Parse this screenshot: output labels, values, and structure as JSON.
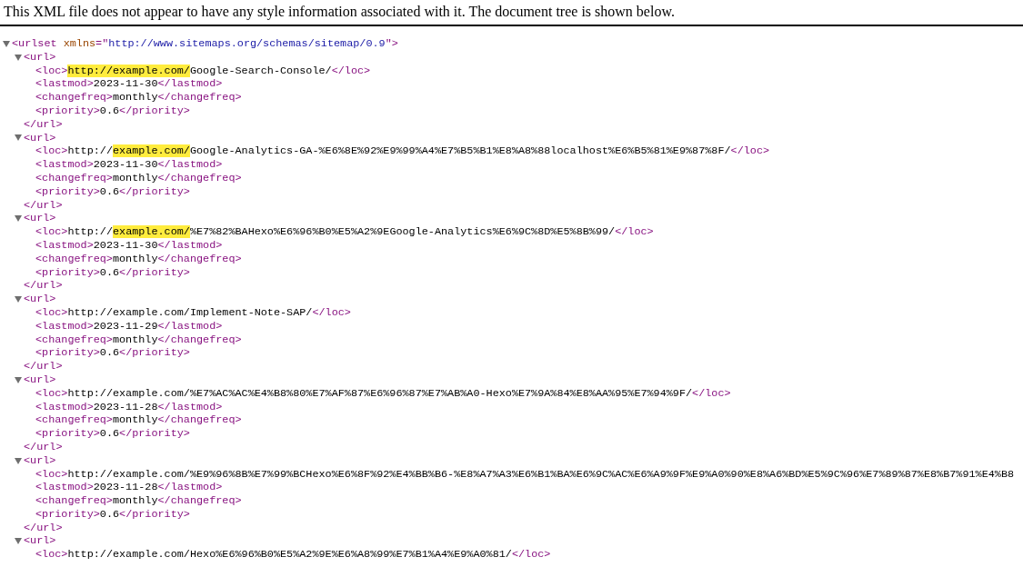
{
  "notice": "This XML file does not appear to have any style information associated with it. The document tree is shown below.",
  "tree": {
    "expanded": true,
    "open": [
      {
        "kind": "tag",
        "text": "<urlset"
      },
      {
        "kind": "attr",
        "text": " xmlns"
      },
      {
        "kind": "tag",
        "text": "=\""
      },
      {
        "kind": "value",
        "text": "http://www.sitemaps.org/schemas/sitemap/0.9"
      },
      {
        "kind": "tag",
        "text": "\">"
      }
    ],
    "children": [
      {
        "expanded": true,
        "open": [
          {
            "kind": "tag",
            "text": "<url>"
          }
        ],
        "close": [
          {
            "kind": "tag",
            "text": "</url>"
          }
        ],
        "children": [
          {
            "line": [
              {
                "kind": "tag",
                "text": "<loc>"
              },
              {
                "kind": "mark",
                "text": "http://example.com/"
              },
              {
                "kind": "text",
                "text": "Google-Search-Console/"
              },
              {
                "kind": "tag",
                "text": "</loc>"
              }
            ]
          },
          {
            "line": [
              {
                "kind": "tag",
                "text": "<lastmod>"
              },
              {
                "kind": "text",
                "text": "2023-11-30"
              },
              {
                "kind": "tag",
                "text": "</lastmod>"
              }
            ]
          },
          {
            "line": [
              {
                "kind": "tag",
                "text": "<changefreq>"
              },
              {
                "kind": "text",
                "text": "monthly"
              },
              {
                "kind": "tag",
                "text": "</changefreq>"
              }
            ]
          },
          {
            "line": [
              {
                "kind": "tag",
                "text": "<priority>"
              },
              {
                "kind": "text",
                "text": "0.6"
              },
              {
                "kind": "tag",
                "text": "</priority>"
              }
            ]
          }
        ]
      },
      {
        "expanded": true,
        "open": [
          {
            "kind": "tag",
            "text": "<url>"
          }
        ],
        "close": [
          {
            "kind": "tag",
            "text": "</url>"
          }
        ],
        "children": [
          {
            "line": [
              {
                "kind": "tag",
                "text": "<loc>"
              },
              {
                "kind": "text",
                "text": "http://"
              },
              {
                "kind": "mark",
                "text": "example.com/"
              },
              {
                "kind": "text",
                "text": "Google-Analytics-GA-%E6%8E%92%E9%99%A4%E7%B5%B1%E8%A8%88localhost%E6%B5%81%E9%87%8F/"
              },
              {
                "kind": "tag",
                "text": "</loc>"
              }
            ]
          },
          {
            "line": [
              {
                "kind": "tag",
                "text": "<lastmod>"
              },
              {
                "kind": "text",
                "text": "2023-11-30"
              },
              {
                "kind": "tag",
                "text": "</lastmod>"
              }
            ]
          },
          {
            "line": [
              {
                "kind": "tag",
                "text": "<changefreq>"
              },
              {
                "kind": "text",
                "text": "monthly"
              },
              {
                "kind": "tag",
                "text": "</changefreq>"
              }
            ]
          },
          {
            "line": [
              {
                "kind": "tag",
                "text": "<priority>"
              },
              {
                "kind": "text",
                "text": "0.6"
              },
              {
                "kind": "tag",
                "text": "</priority>"
              }
            ]
          }
        ]
      },
      {
        "expanded": true,
        "open": [
          {
            "kind": "tag",
            "text": "<url>"
          }
        ],
        "close": [
          {
            "kind": "tag",
            "text": "</url>"
          }
        ],
        "children": [
          {
            "line": [
              {
                "kind": "tag",
                "text": "<loc>"
              },
              {
                "kind": "text",
                "text": "http://"
              },
              {
                "kind": "mark",
                "text": "example.com/"
              },
              {
                "kind": "text",
                "text": "%E7%82%BAHexo%E6%96%B0%E5%A2%9EGoogle-Analytics%E6%9C%8D%E5%8B%99/"
              },
              {
                "kind": "tag",
                "text": "</loc>"
              }
            ]
          },
          {
            "line": [
              {
                "kind": "tag",
                "text": "<lastmod>"
              },
              {
                "kind": "text",
                "text": "2023-11-30"
              },
              {
                "kind": "tag",
                "text": "</lastmod>"
              }
            ]
          },
          {
            "line": [
              {
                "kind": "tag",
                "text": "<changefreq>"
              },
              {
                "kind": "text",
                "text": "monthly"
              },
              {
                "kind": "tag",
                "text": "</changefreq>"
              }
            ]
          },
          {
            "line": [
              {
                "kind": "tag",
                "text": "<priority>"
              },
              {
                "kind": "text",
                "text": "0.6"
              },
              {
                "kind": "tag",
                "text": "</priority>"
              }
            ]
          }
        ]
      },
      {
        "expanded": true,
        "open": [
          {
            "kind": "tag",
            "text": "<url>"
          }
        ],
        "close": [
          {
            "kind": "tag",
            "text": "</url>"
          }
        ],
        "children": [
          {
            "line": [
              {
                "kind": "tag",
                "text": "<loc>"
              },
              {
                "kind": "text",
                "text": "http://example.com/Implement-Note-SAP/"
              },
              {
                "kind": "tag",
                "text": "</loc>"
              }
            ]
          },
          {
            "line": [
              {
                "kind": "tag",
                "text": "<lastmod>"
              },
              {
                "kind": "text",
                "text": "2023-11-29"
              },
              {
                "kind": "tag",
                "text": "</lastmod>"
              }
            ]
          },
          {
            "line": [
              {
                "kind": "tag",
                "text": "<changefreq>"
              },
              {
                "kind": "text",
                "text": "monthly"
              },
              {
                "kind": "tag",
                "text": "</changefreq>"
              }
            ]
          },
          {
            "line": [
              {
                "kind": "tag",
                "text": "<priority>"
              },
              {
                "kind": "text",
                "text": "0.6"
              },
              {
                "kind": "tag",
                "text": "</priority>"
              }
            ]
          }
        ]
      },
      {
        "expanded": true,
        "open": [
          {
            "kind": "tag",
            "text": "<url>"
          }
        ],
        "close": [
          {
            "kind": "tag",
            "text": "</url>"
          }
        ],
        "children": [
          {
            "line": [
              {
                "kind": "tag",
                "text": "<loc>"
              },
              {
                "kind": "text",
                "text": "http://example.com/%E7%AC%AC%E4%B8%80%E7%AF%87%E6%96%87%E7%AB%A0-Hexo%E7%9A%84%E8%AA%95%E7%94%9F/"
              },
              {
                "kind": "tag",
                "text": "</loc>"
              }
            ]
          },
          {
            "line": [
              {
                "kind": "tag",
                "text": "<lastmod>"
              },
              {
                "kind": "text",
                "text": "2023-11-28"
              },
              {
                "kind": "tag",
                "text": "</lastmod>"
              }
            ]
          },
          {
            "line": [
              {
                "kind": "tag",
                "text": "<changefreq>"
              },
              {
                "kind": "text",
                "text": "monthly"
              },
              {
                "kind": "tag",
                "text": "</changefreq>"
              }
            ]
          },
          {
            "line": [
              {
                "kind": "tag",
                "text": "<priority>"
              },
              {
                "kind": "text",
                "text": "0.6"
              },
              {
                "kind": "tag",
                "text": "</priority>"
              }
            ]
          }
        ]
      },
      {
        "expanded": true,
        "open": [
          {
            "kind": "tag",
            "text": "<url>"
          }
        ],
        "close": [
          {
            "kind": "tag",
            "text": "</url>"
          }
        ],
        "children": [
          {
            "line": [
              {
                "kind": "tag",
                "text": "<loc>"
              },
              {
                "kind": "text",
                "text": "http://example.com/%E9%96%8B%E7%99%BCHexo%E6%8F%92%E4%BB%B6-%E8%A7%A3%E6%B1%BA%E6%9C%AC%E6%A9%9F%E9%A0%90%E8%A6%BD%E5%9C%96%E7%89%87%E8%B7%91%E4%B8"
              }
            ]
          },
          {
            "line": [
              {
                "kind": "tag",
                "text": "<lastmod>"
              },
              {
                "kind": "text",
                "text": "2023-11-28"
              },
              {
                "kind": "tag",
                "text": "</lastmod>"
              }
            ]
          },
          {
            "line": [
              {
                "kind": "tag",
                "text": "<changefreq>"
              },
              {
                "kind": "text",
                "text": "monthly"
              },
              {
                "kind": "tag",
                "text": "</changefreq>"
              }
            ]
          },
          {
            "line": [
              {
                "kind": "tag",
                "text": "<priority>"
              },
              {
                "kind": "text",
                "text": "0.6"
              },
              {
                "kind": "tag",
                "text": "</priority>"
              }
            ]
          }
        ]
      },
      {
        "expanded": true,
        "open": [
          {
            "kind": "tag",
            "text": "<url>"
          }
        ],
        "children": [
          {
            "line": [
              {
                "kind": "tag",
                "text": "<loc>"
              },
              {
                "kind": "text",
                "text": "http://example.com/Hexo%E6%96%B0%E5%A2%9E%E6%A8%99%E7%B1%A4%E9%A0%81/"
              },
              {
                "kind": "tag",
                "text": "</loc>"
              }
            ]
          }
        ]
      }
    ]
  }
}
